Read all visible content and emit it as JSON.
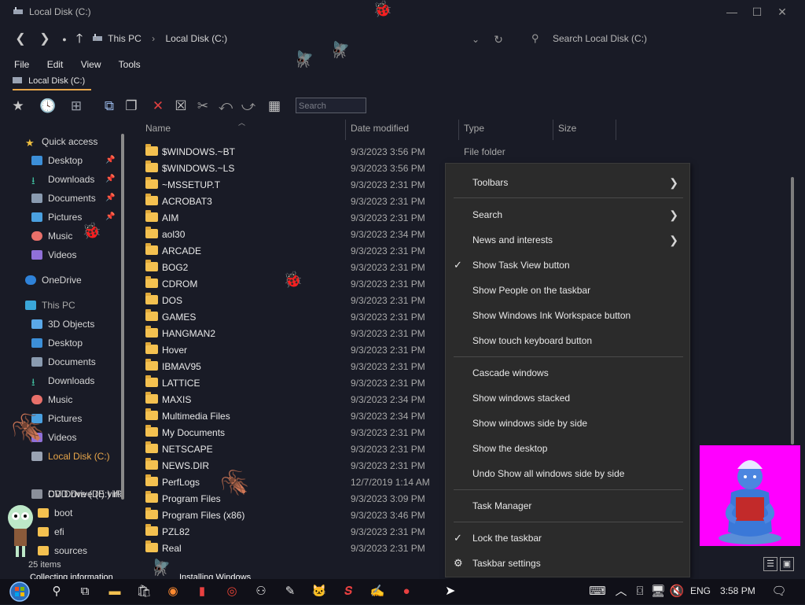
{
  "window": {
    "title": "Local Disk (C:)",
    "controls": [
      "—",
      "☐",
      "✕"
    ]
  },
  "addressbar": {
    "breadcrumbs": [
      "This PC",
      "Local Disk (C:)"
    ],
    "search_placeholder": "Search Local Disk (C:)"
  },
  "menubar": [
    "File",
    "Edit",
    "View",
    "Tools"
  ],
  "tab": {
    "label": "Local Disk (C:)"
  },
  "toolbar": {
    "search_placeholder": "Search"
  },
  "nav": {
    "quick_access": "Quick access",
    "quick_items": [
      "Desktop",
      "Downloads",
      "Documents",
      "Pictures",
      "Music",
      "Videos"
    ],
    "onedrive": "OneDrive",
    "this_pc": "This PC",
    "pc_items": [
      "3D Objects",
      "Desktop",
      "Documents",
      "Downloads",
      "Music",
      "Pictures",
      "Videos",
      "Local Disk (C:)",
      "CD Drive (D:) virt",
      "DVD Drive (E:) IR",
      "boot",
      "efi",
      "sources"
    ]
  },
  "columns": {
    "name": "Name",
    "date": "Date modified",
    "type": "Type",
    "size": "Size"
  },
  "files": [
    {
      "name": "$WINDOWS.~BT",
      "date": "9/3/2023 3:56 PM",
      "type": "File folder"
    },
    {
      "name": "$WINDOWS.~LS",
      "date": "9/3/2023 3:56 PM",
      "type": ""
    },
    {
      "name": "~MSSETUP.T",
      "date": "9/3/2023 2:31 PM",
      "type": ""
    },
    {
      "name": "ACROBAT3",
      "date": "9/3/2023 2:31 PM",
      "type": ""
    },
    {
      "name": "AIM",
      "date": "9/3/2023 2:31 PM",
      "type": ""
    },
    {
      "name": "aol30",
      "date": "9/3/2023 2:34 PM",
      "type": ""
    },
    {
      "name": "ARCADE",
      "date": "9/3/2023 2:31 PM",
      "type": ""
    },
    {
      "name": "BOG2",
      "date": "9/3/2023 2:31 PM",
      "type": ""
    },
    {
      "name": "CDROM",
      "date": "9/3/2023 2:31 PM",
      "type": ""
    },
    {
      "name": "DOS",
      "date": "9/3/2023 2:31 PM",
      "type": ""
    },
    {
      "name": "GAMES",
      "date": "9/3/2023 2:31 PM",
      "type": ""
    },
    {
      "name": "HANGMAN2",
      "date": "9/3/2023 2:31 PM",
      "type": ""
    },
    {
      "name": "Hover",
      "date": "9/3/2023 2:31 PM",
      "type": ""
    },
    {
      "name": "IBMAV95",
      "date": "9/3/2023 2:31 PM",
      "type": ""
    },
    {
      "name": "LATTICE",
      "date": "9/3/2023 2:31 PM",
      "type": ""
    },
    {
      "name": "MAXIS",
      "date": "9/3/2023 2:34 PM",
      "type": ""
    },
    {
      "name": "Multimedia Files",
      "date": "9/3/2023 2:34 PM",
      "type": ""
    },
    {
      "name": "My Documents",
      "date": "9/3/2023 2:31 PM",
      "type": ""
    },
    {
      "name": "NETSCAPE",
      "date": "9/3/2023 2:31 PM",
      "type": ""
    },
    {
      "name": "NEWS.DIR",
      "date": "9/3/2023 2:31 PM",
      "type": ""
    },
    {
      "name": "PerfLogs",
      "date": "12/7/2019 1:14 AM",
      "type": ""
    },
    {
      "name": "Program Files",
      "date": "9/3/2023 3:09 PM",
      "type": ""
    },
    {
      "name": "Program Files (x86)",
      "date": "9/3/2023 3:46 PM",
      "type": ""
    },
    {
      "name": "PZL82",
      "date": "9/3/2023 2:31 PM",
      "type": ""
    },
    {
      "name": "Real",
      "date": "9/3/2023 2:31 PM",
      "type": ""
    }
  ],
  "context_menu": {
    "toolbars": "Toolbars",
    "search": "Search",
    "news": "News and interests",
    "task_view": "Show Task View button",
    "people": "Show People on the taskbar",
    "ink": "Show Windows Ink Workspace button",
    "touch_kb": "Show touch keyboard button",
    "cascade": "Cascade windows",
    "stacked": "Show windows stacked",
    "side_by_side": "Show windows side by side",
    "desktop": "Show the desktop",
    "undo": "Undo Show all windows side by side",
    "task_manager": "Task Manager",
    "lock": "Lock the taskbar",
    "settings": "Taskbar settings"
  },
  "status": {
    "items": "25 items",
    "collecting": "Collecting information",
    "installing": "Installing Windows"
  },
  "taskbar": {
    "lang": "ENG",
    "time": "3:58 PM"
  },
  "colors": {
    "accent": "#e8a64a",
    "folder": "#f4c150",
    "genie_bg": "#ff00ff"
  }
}
